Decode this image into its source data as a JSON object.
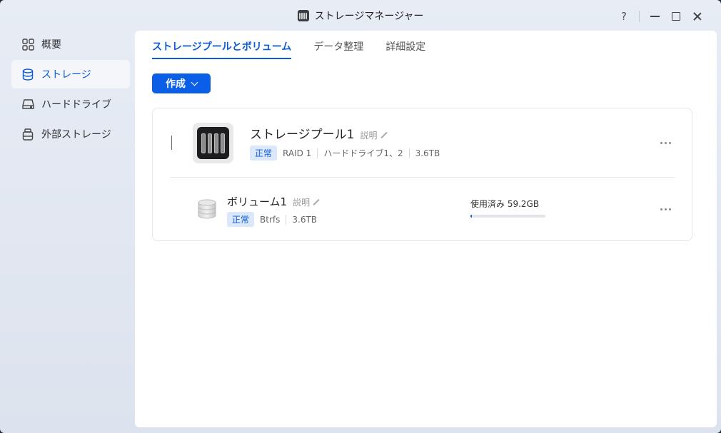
{
  "window": {
    "title": "ストレージマネージャー",
    "help": "?"
  },
  "sidebar": {
    "items": [
      {
        "label": "概要",
        "icon": "grid-icon",
        "active": false
      },
      {
        "label": "ストレージ",
        "icon": "database-icon",
        "active": true
      },
      {
        "label": "ハードドライブ",
        "icon": "hard-drive-icon",
        "active": false
      },
      {
        "label": "外部ストレージ",
        "icon": "external-storage-icon",
        "active": false
      }
    ]
  },
  "tabs": [
    {
      "label": "ストレージプールとボリューム",
      "active": true
    },
    {
      "label": "データ整理",
      "active": false
    },
    {
      "label": "詳細設定",
      "active": false
    }
  ],
  "toolbar": {
    "create_label": "作成"
  },
  "pool": {
    "name": "ストレージプール1",
    "desc_label": "説明",
    "status": "正常",
    "raid": "RAID 1",
    "drives": "ハードドライブ1、2",
    "size": "3.6TB"
  },
  "volume": {
    "name": "ボリューム1",
    "desc_label": "説明",
    "status": "正常",
    "fs": "Btrfs",
    "size": "3.6TB",
    "usage_label": "使用済み 59.2GB",
    "usage_fraction": 0.016
  },
  "colors": {
    "accent": "#0a5fe6",
    "badge_bg": "#dbe8fb"
  }
}
